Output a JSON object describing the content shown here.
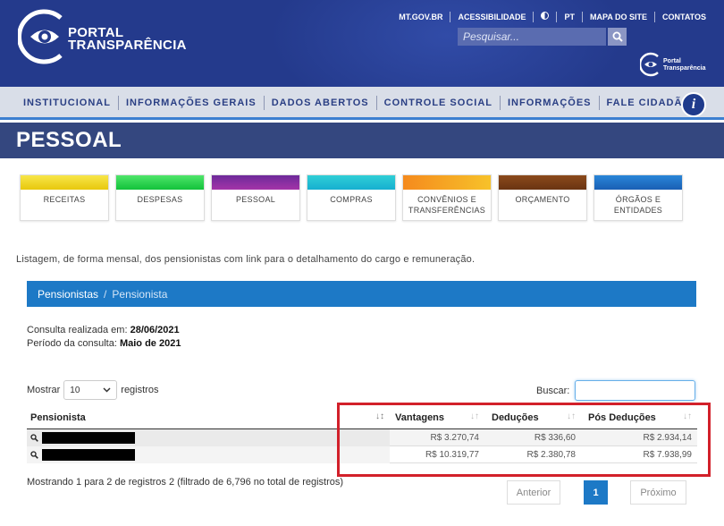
{
  "header": {
    "logo_line1": "PORTAL",
    "logo_line2": "TRANSPARÊNCIA",
    "top_links": [
      "MT.GOV.BR",
      "ACESSIBILIDADE",
      "PT",
      "MAPA DO SITE",
      "CONTATOS"
    ],
    "search_placeholder": "Pesquisar...",
    "small_logo_line1": "Portal",
    "small_logo_line2": "Transparência",
    "colors": {
      "primary": "#243a8c",
      "accent": "#1d79c6"
    }
  },
  "nav": {
    "items": [
      "INSTITUCIONAL",
      "INFORMAÇÕES GERAIS",
      "DADOS ABERTOS",
      "CONTROLE SOCIAL",
      "INFORMAÇÕES",
      "FALE CIDADÃO"
    ],
    "info_label": "i"
  },
  "page": {
    "title": "PESSOAL"
  },
  "categories": [
    {
      "label": "RECEITAS",
      "color": "#f2d81c"
    },
    {
      "label": "DESPESAS",
      "color": "#1ed449"
    },
    {
      "label": "PESSOAL",
      "color": "#8a2ea0"
    },
    {
      "label": "COMPRAS",
      "color": "#22c0d3"
    },
    {
      "label": "CONVÊNIOS E TRANSFERÊNCIAS",
      "color": "#f5a11d"
    },
    {
      "label": "ORÇAMENTO",
      "color": "#7b3f17"
    },
    {
      "label": "ÓRGÃOS E ENTIDADES",
      "color": "#1e73c8"
    }
  ],
  "description": "Listagem, de forma mensal, dos pensionistas com link para o detalhamento do cargo e remuneração.",
  "breadcrumb": {
    "parent": "Pensionistas",
    "separator": "/",
    "current": "Pensionista"
  },
  "consult": {
    "date_label": "Consulta realizada em:",
    "date_value": "28/06/2021",
    "period_label": "Período da consulta:",
    "period_value": "Maio de 2021"
  },
  "controls": {
    "show_label": "Mostrar",
    "show_value": "10",
    "records_label": "registros",
    "search_label": "Buscar:",
    "search_value": ""
  },
  "table": {
    "headers": [
      "Pensionista",
      "Vantagens",
      "Deduções",
      "Pós Deduções"
    ],
    "rows": [
      {
        "vantagens": "R$ 3.270,74",
        "deducoes": "R$ 336,60",
        "pos": "R$ 2.934,14"
      },
      {
        "vantagens": "R$ 10.319,77",
        "deducoes": "R$ 2.380,78",
        "pos": "R$ 7.938,99"
      }
    ]
  },
  "footer": {
    "info": "Mostrando 1 para 2 de registros 2 (filtrado de 6,796 no total de registros)",
    "prev": "Anterior",
    "page": "1",
    "next": "Próximo"
  }
}
